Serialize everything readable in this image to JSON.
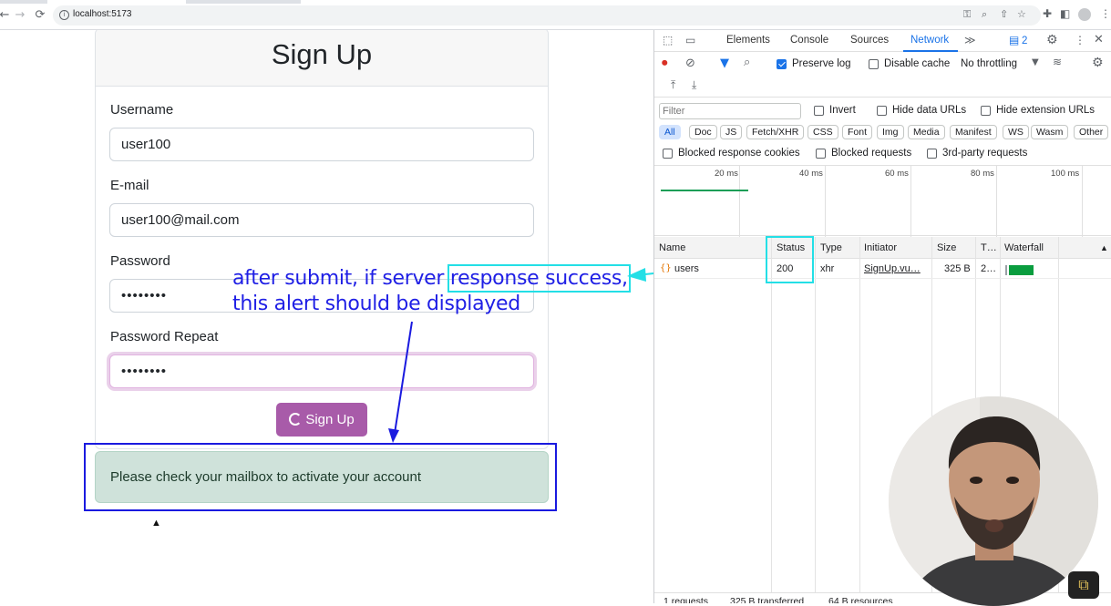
{
  "browser": {
    "url": "localhost:5173",
    "nav": {
      "back": "←",
      "forward": "→",
      "reload": "⟳"
    }
  },
  "form": {
    "title": "Sign Up",
    "username_label": "Username",
    "username_value": "user100",
    "email_label": "E-mail",
    "email_value": "user100@mail.com",
    "password_label": "Password",
    "password_value": "••••••••",
    "password_repeat_label": "Password Repeat",
    "password_repeat_value": "••••••••",
    "submit_label": "Sign Up",
    "success_alert": "Please check your mailbox to activate your account"
  },
  "annotation": {
    "line1_pre": "after submit, if server ",
    "line1_box": "response success,",
    "line2": "this alert should be displayed",
    "color": "#1f1fe5",
    "highlight_color": "#23dfe6"
  },
  "devtools": {
    "tabs": [
      "Elements",
      "Console",
      "Sources",
      "Network"
    ],
    "active_tab": "Network",
    "more_tabs": "≫",
    "issues_count": "2",
    "preserve_log": "Preserve log",
    "disable_cache": "Disable cache",
    "throttling": "No throttling",
    "filter_placeholder": "Filter",
    "invert": "Invert",
    "hide_data_urls": "Hide data URLs",
    "hide_extension_urls": "Hide extension URLs",
    "type_filters": [
      "All",
      "Doc",
      "JS",
      "Fetch/XHR",
      "CSS",
      "Font",
      "Img",
      "Media",
      "Manifest",
      "WS",
      "Wasm",
      "Other"
    ],
    "blocked_cookies": "Blocked response cookies",
    "blocked_requests": "Blocked requests",
    "third_party": "3rd-party requests",
    "timeline_ticks": [
      "20 ms",
      "40 ms",
      "60 ms",
      "80 ms",
      "100 ms"
    ],
    "columns": {
      "name": "Name",
      "status": "Status",
      "type": "Type",
      "initiator": "Initiator",
      "size": "Size",
      "time": "T…",
      "waterfall": "Waterfall"
    },
    "request": {
      "name": "users",
      "status": "200",
      "type": "xhr",
      "initiator": "SignUp.vu…",
      "size": "325 B",
      "time": "2…"
    },
    "footer": {
      "requests": "1 requests",
      "transferred": "325 B transferred",
      "resources": "64 B resources"
    }
  }
}
